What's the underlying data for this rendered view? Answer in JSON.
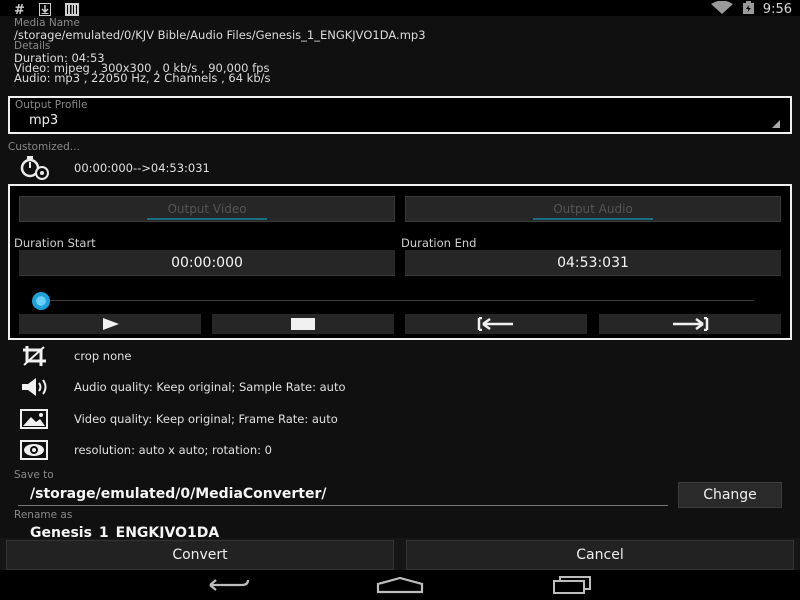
{
  "status_bar": {
    "left_icons": [
      "hash-icon",
      "download-icon",
      "barcode-icon"
    ],
    "time": "9:56"
  },
  "media": {
    "name_label": "Media Name",
    "path": "/storage/emulated/0/KJV Bible/Audio Files/Genesis_1_ENGKJVO1DA.mp3",
    "details_label": "Details",
    "duration": "Duration: 04:53",
    "video": "Video: mjpeg , 300x300 , 0 kb/s , 90,000 fps",
    "audio": "Audio: mp3 , 22050 Hz, 2 Channels , 64 kb/s"
  },
  "output_profile": {
    "label": "Output Profile",
    "value": "mp3"
  },
  "customized": {
    "label": "Customized...",
    "range": "00:00:000-->04:53:031"
  },
  "editor": {
    "tab_video": "Output Video",
    "tab_audio": "Output Audio",
    "start_label": "Duration Start",
    "start_value": "00:00:000",
    "end_label": "Duration End",
    "end_value": "04:53:031",
    "seek_position": 0.0
  },
  "options": {
    "crop": "crop none",
    "audio_quality": "Audio quality: Keep original; Sample Rate: auto",
    "video_quality": "Video quality: Keep original; Frame Rate: auto",
    "resolution": "resolution: auto x auto; rotation: 0"
  },
  "save": {
    "label": "Save to",
    "path": "/storage/emulated/0/MediaConverter/",
    "change_label": "Change"
  },
  "rename": {
    "label": "Rename as",
    "value": "Genesis_1_ENGKJVO1DA"
  },
  "actions": {
    "convert": "Convert",
    "cancel": "Cancel"
  },
  "colors": {
    "accent": "#1ea0d8",
    "background": "#101010",
    "border": "#f0f0f0"
  }
}
